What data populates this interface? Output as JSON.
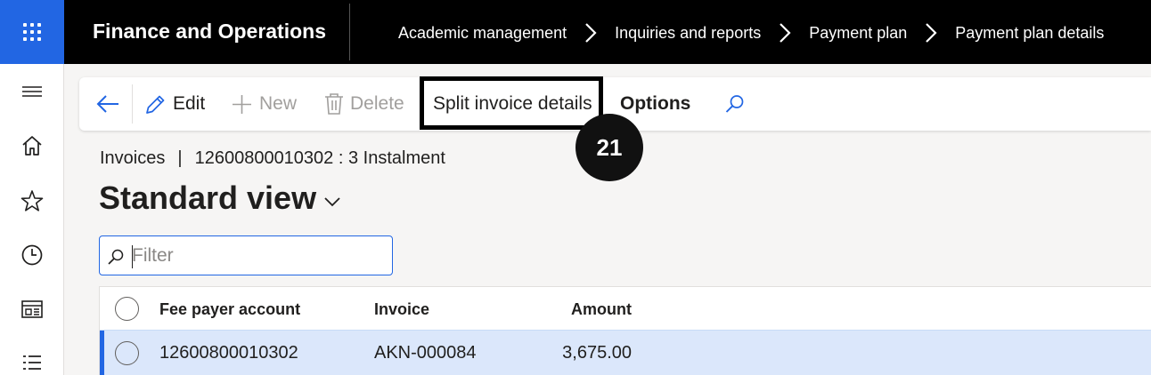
{
  "header": {
    "app_title": "Finance and Operations",
    "breadcrumbs": [
      "Academic management",
      "Inquiries and reports",
      "Payment plan",
      "Payment plan details"
    ]
  },
  "actions": {
    "edit": "Edit",
    "new": "New",
    "delete": "Delete",
    "split_invoice": "Split invoice details",
    "options": "Options"
  },
  "annotation": {
    "step": "21"
  },
  "page": {
    "caption_left": "Invoices",
    "caption_separator": "|",
    "caption_right": "12600800010302 : 3 Instalment",
    "view_title": "Standard view"
  },
  "filter": {
    "placeholder": "Filter"
  },
  "grid": {
    "columns": [
      "Fee payer account",
      "Invoice",
      "Amount"
    ],
    "rows": [
      {
        "fee_payer_account": "12600800010302",
        "invoice": "AKN-000084",
        "amount": "3,675.00"
      }
    ]
  },
  "colors": {
    "accent": "#2266e3",
    "topbar": "#000000",
    "selected_row": "#dbe7fb"
  }
}
